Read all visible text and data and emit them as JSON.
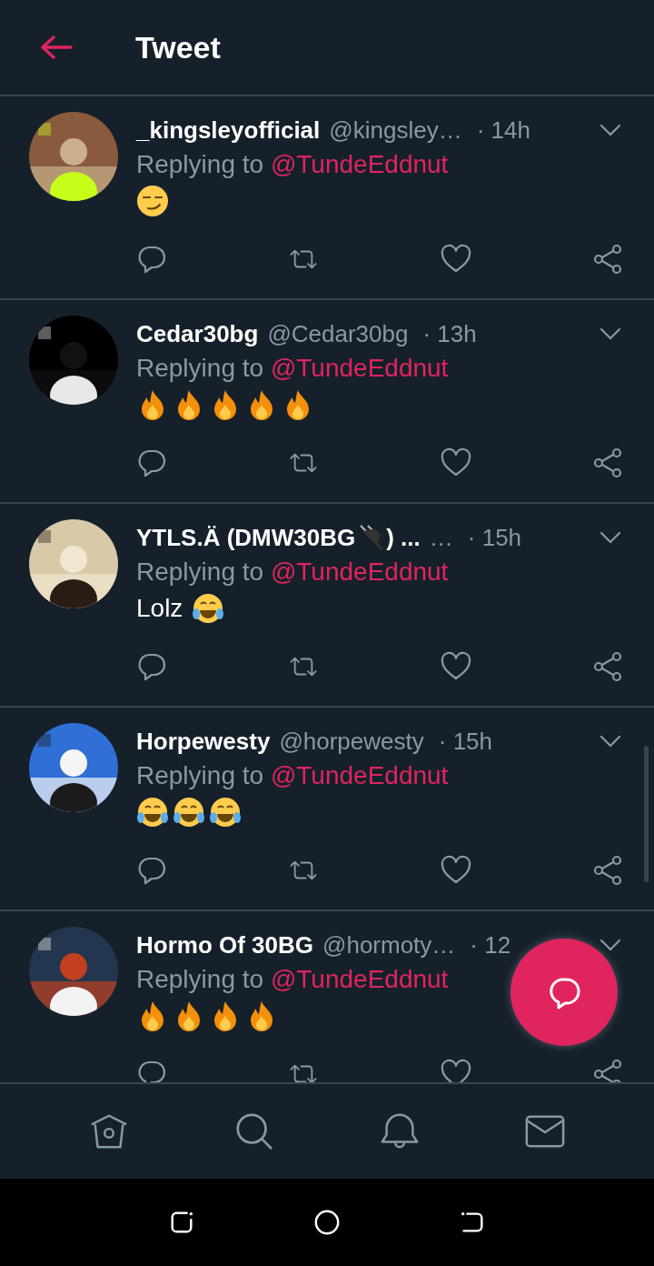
{
  "header": {
    "title": "Tweet"
  },
  "tweets": [
    {
      "name": "_kingsleyofficial",
      "handle": "@kingsley…",
      "time": "· 14h",
      "replying_label": "Replying to",
      "reply_to": "@TundeEddnut",
      "emojis": [
        {
          "kind": "smirk"
        }
      ]
    },
    {
      "name": "Cedar30bg",
      "handle": "@Cedar30bg",
      "time": "· 13h",
      "replying_label": "Replying to",
      "reply_to": "@TundeEddnut",
      "emojis": [
        {
          "kind": "fire"
        },
        {
          "kind": "fire"
        },
        {
          "kind": "fire"
        },
        {
          "kind": "fire"
        },
        {
          "kind": "fire"
        }
      ]
    },
    {
      "name": "YTLS.Ä (DMW30BG",
      "name_icon": {
        "kind": "plug"
      },
      "name_suffix": ") ...",
      "handle": "…",
      "time": "· 15h",
      "replying_label": "Replying to",
      "reply_to": "@TundeEddnut",
      "text": "Lolz",
      "emojis": [
        {
          "kind": "joy"
        }
      ]
    },
    {
      "name": "Horpewesty",
      "handle": "@horpewesty",
      "time": "· 15h",
      "replying_label": "Replying to",
      "reply_to": "@TundeEddnut",
      "emojis": [
        {
          "kind": "joy"
        },
        {
          "kind": "joy"
        },
        {
          "kind": "joy"
        }
      ]
    },
    {
      "name": "Hormo Of 30BG",
      "handle": "@hormoty…",
      "time": "· 12",
      "replying_label": "Replying to",
      "reply_to": "@TundeEddnut",
      "emojis": [
        {
          "kind": "fire"
        },
        {
          "kind": "fire"
        },
        {
          "kind": "fire"
        },
        {
          "kind": "fire"
        }
      ]
    }
  ]
}
